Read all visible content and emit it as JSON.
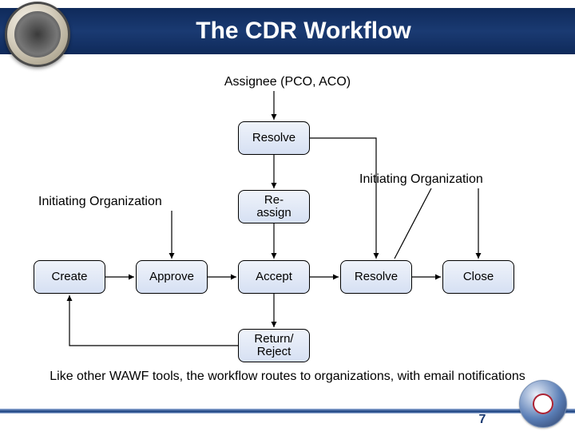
{
  "header": {
    "title": "The CDR Workflow"
  },
  "labels": {
    "assignee": "Assignee (PCO, ACO)",
    "initiating_left": "Initiating Organization",
    "initiating_right": "Initiating Organization"
  },
  "nodes": {
    "resolve_top": "Resolve",
    "reassign": "Re-\nassign",
    "create": "Create",
    "approve": "Approve",
    "accept": "Accept",
    "resolve_bottom": "Resolve",
    "close": "Close",
    "return_reject": "Return/\nReject"
  },
  "caption": "Like other WAWF tools, the workflow routes to organizations, with email notifications",
  "page_number": "7"
}
